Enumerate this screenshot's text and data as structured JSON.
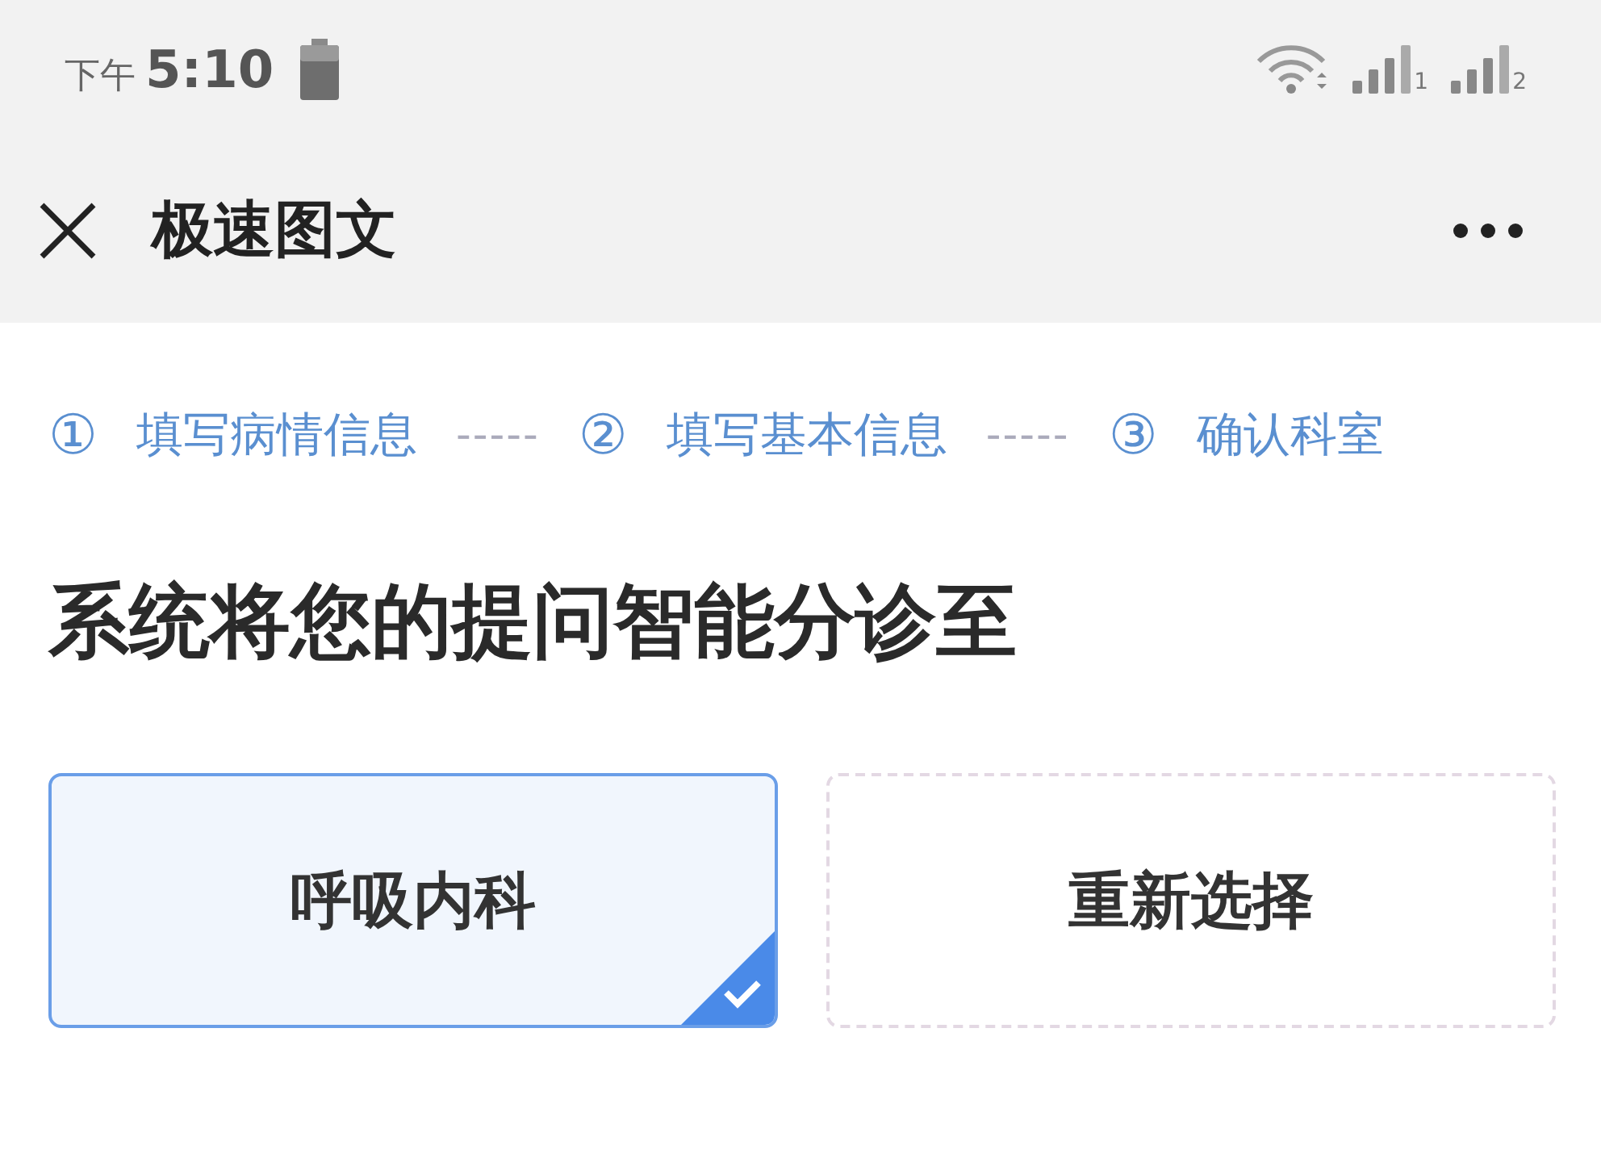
{
  "status_bar": {
    "period": "下午",
    "time": "5:10",
    "sim_labels": [
      "1",
      "2"
    ]
  },
  "nav_bar": {
    "title": "极速图文"
  },
  "steps": [
    {
      "number": "①",
      "label": "填写病情信息",
      "separator": "-----"
    },
    {
      "number": "②",
      "label": "填写基本信息",
      "separator": "-----"
    },
    {
      "number": "③",
      "label": "确认科室"
    }
  ],
  "heading": "系统将您的提问智能分诊至",
  "options": [
    {
      "label": "呼吸内科",
      "selected": true
    },
    {
      "label": "重新选择",
      "selected": false
    }
  ]
}
